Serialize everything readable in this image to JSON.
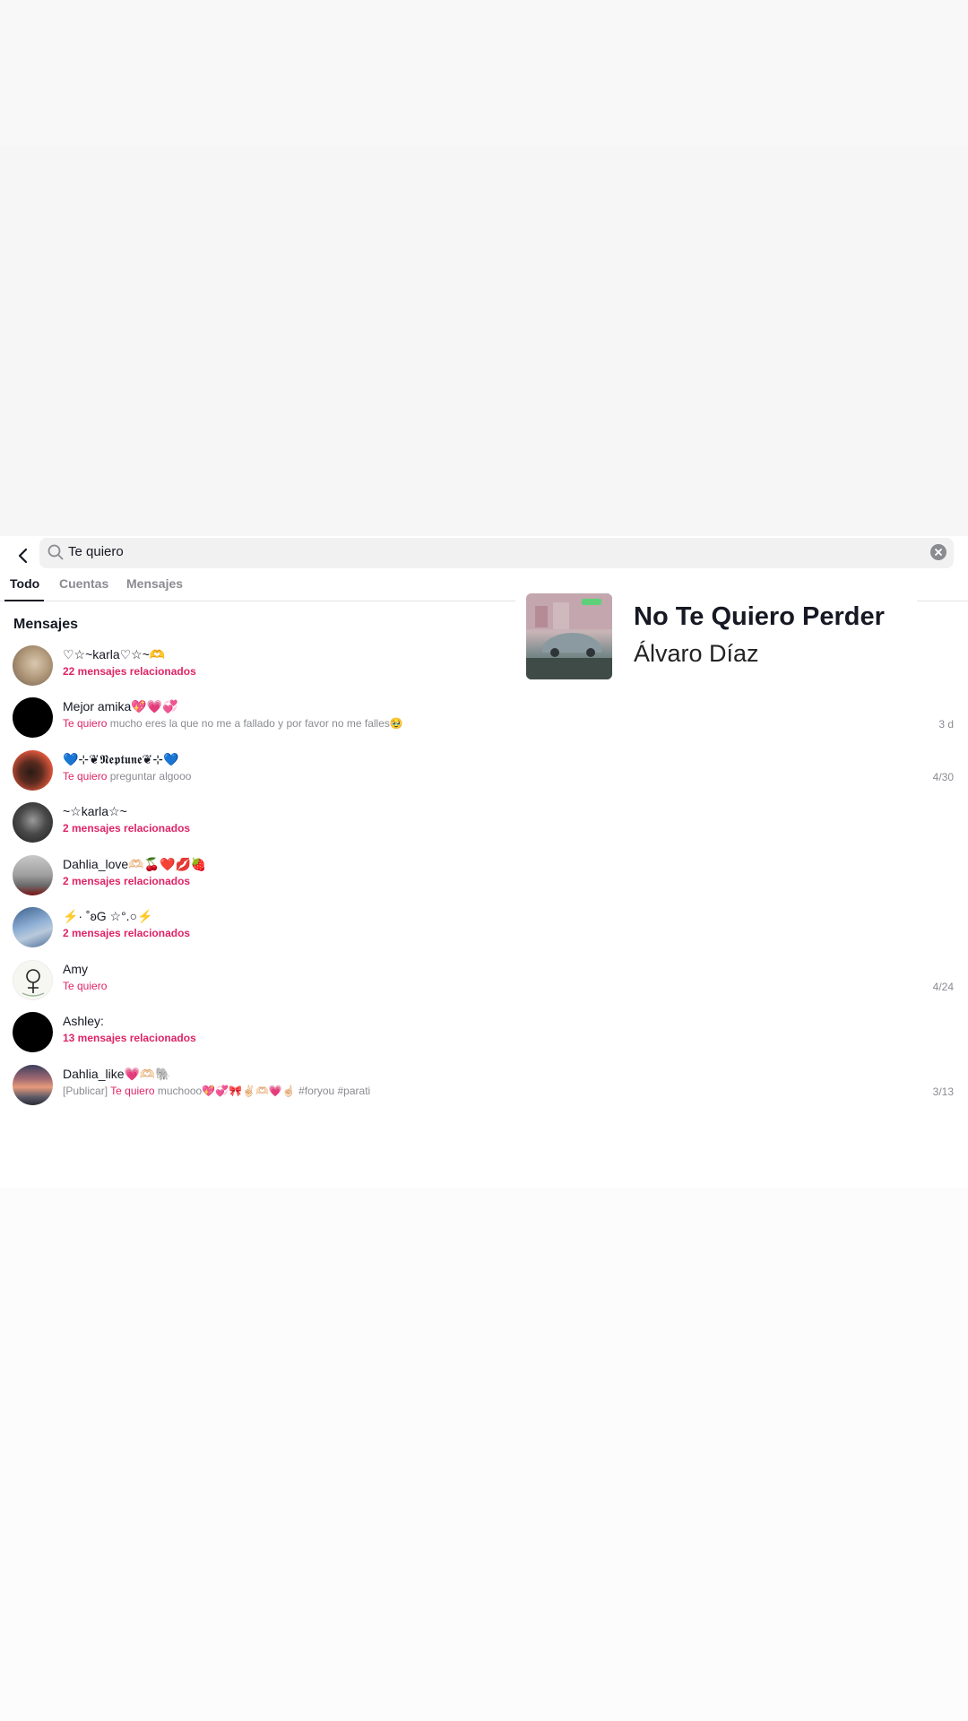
{
  "search": {
    "query": "Te quiero"
  },
  "tabs": [
    {
      "label": "Todo",
      "active": true
    },
    {
      "label": "Cuentas",
      "active": false
    },
    {
      "label": "Mensajes",
      "active": false
    }
  ],
  "section": {
    "title": "Mensajes"
  },
  "song": {
    "title": "No Te Quiero Perder",
    "artist": "Álvaro Díaz"
  },
  "rows": [
    {
      "name": "♡☆~karla♡☆~🫶",
      "related": "22 mensajes relacionados"
    },
    {
      "name": "Mejor amika💖💗💞",
      "highlight": "Te quiero",
      "text": " mucho eres la que no me a fallado y por favor no me falles🥹",
      "date": "3 d"
    },
    {
      "name": "💙⊹❦𝕹𝖊𝖕𝖙𝖚𝖓𝖊❦⊹💙",
      "highlight": "Te quiero",
      "text": " preguntar algooo",
      "date": "4/30"
    },
    {
      "name": "~☆karla☆~",
      "related": "2 mensajes relacionados"
    },
    {
      "name": "Dahlia_love🫶🏻🍒❤️💋🍓",
      "related": "2 mensajes relacionados"
    },
    {
      "name": "⚡· ˚ʚG ☆°.○⚡",
      "related": "2 mensajes relacionados"
    },
    {
      "name": "Amy",
      "highlight": "Te quiero",
      "text": "",
      "date": "4/24"
    },
    {
      "name": "Ashley:",
      "related": "13 mensajes relacionados"
    },
    {
      "name": "Dahlia_like💗🫶🏻🐘",
      "prefix": "[Publicar] ",
      "highlight": "Te quiero",
      "text": " muchooo💖💞🎀✌🏻🫶🏻💗☝🏻 #foryou #parati",
      "date": "3/13"
    }
  ],
  "colors": {
    "accent": "#de2466",
    "text": "#161823",
    "muted": "#8a8b91"
  },
  "icons": [
    "back-arrow-icon",
    "search-icon",
    "clear-icon"
  ]
}
